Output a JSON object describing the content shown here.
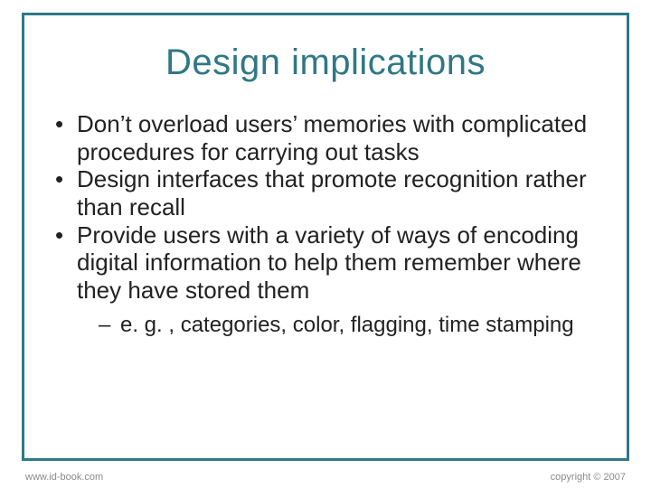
{
  "slide": {
    "title": "Design implications",
    "bullets": [
      "Don’t overload users’ memories with complicated procedures for carrying out tasks",
      "Design interfaces that promote recognition rather than recall",
      "Provide users with a variety of ways of encoding digital information to help them remember where they have stored them"
    ],
    "subbullets": [
      "e. g. , categories, color, flagging, time stamping"
    ]
  },
  "footer": {
    "url": "www.id-book.com",
    "copyright": "copyright © 2007"
  }
}
